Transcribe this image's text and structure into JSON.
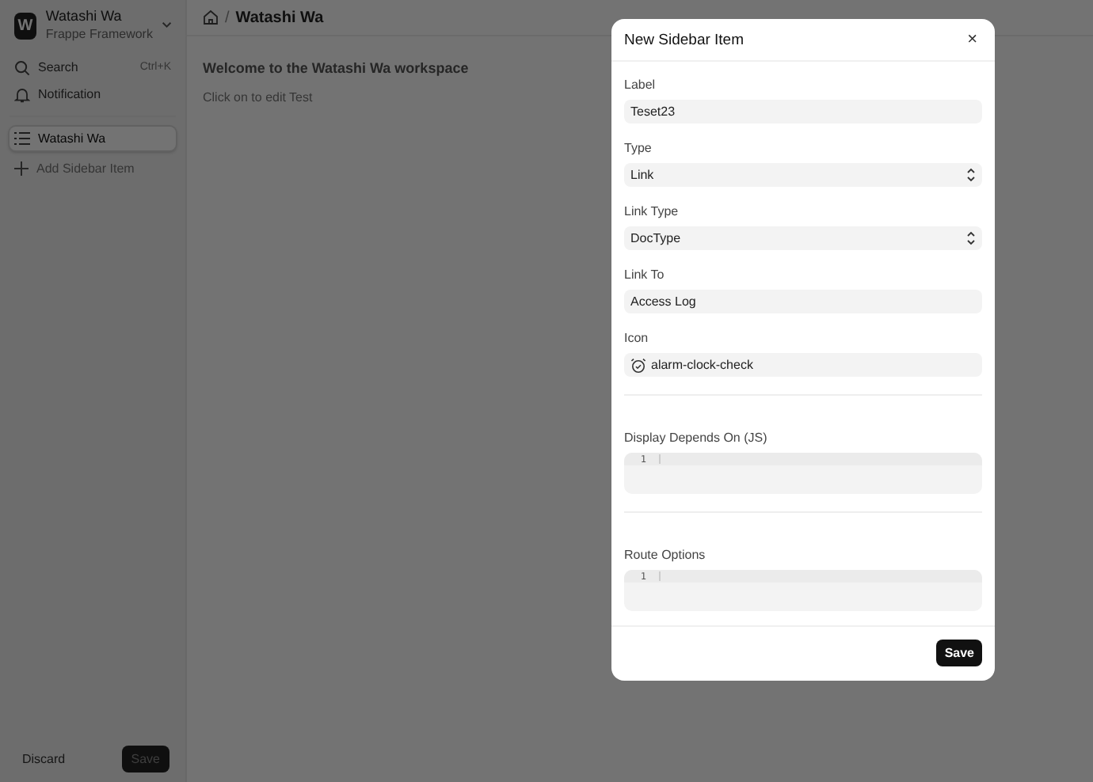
{
  "sidebar": {
    "workspace": {
      "initial": "W",
      "name": "Watashi Wa",
      "subtitle": "Frappe Framework"
    },
    "items": [
      {
        "kind": "search",
        "label": "Search",
        "shortcut": "Ctrl+K"
      },
      {
        "kind": "notification",
        "label": "Notification"
      }
    ],
    "pages": [
      {
        "label": "Watashi Wa",
        "selected": true
      }
    ],
    "add_item": "Add Sidebar Item",
    "discard": "Discard",
    "save": "Save"
  },
  "main": {
    "separator": "/",
    "breadcrumb": "Watashi Wa",
    "heading": "Welcome to the Watashi Wa workspace",
    "subtext": "Click on to edit Test"
  },
  "dialog": {
    "title": "New Sidebar Item",
    "close": "×",
    "fields": [
      {
        "kind": "text",
        "label": "Label",
        "value": "Teset23"
      },
      {
        "kind": "select",
        "label": "Type",
        "value": "Link"
      },
      {
        "kind": "select",
        "label": "Link Type",
        "value": "DocType"
      },
      {
        "kind": "text",
        "label": "Link To",
        "value": "Access Log"
      },
      {
        "kind": "icon",
        "label": "Icon",
        "value": "alarm-clock-check"
      },
      {
        "kind": "code",
        "label": "Display Depends On (JS)",
        "line_number": "1"
      },
      {
        "kind": "code",
        "label": "Route Options",
        "line_number": "1"
      }
    ],
    "save": "Save"
  }
}
